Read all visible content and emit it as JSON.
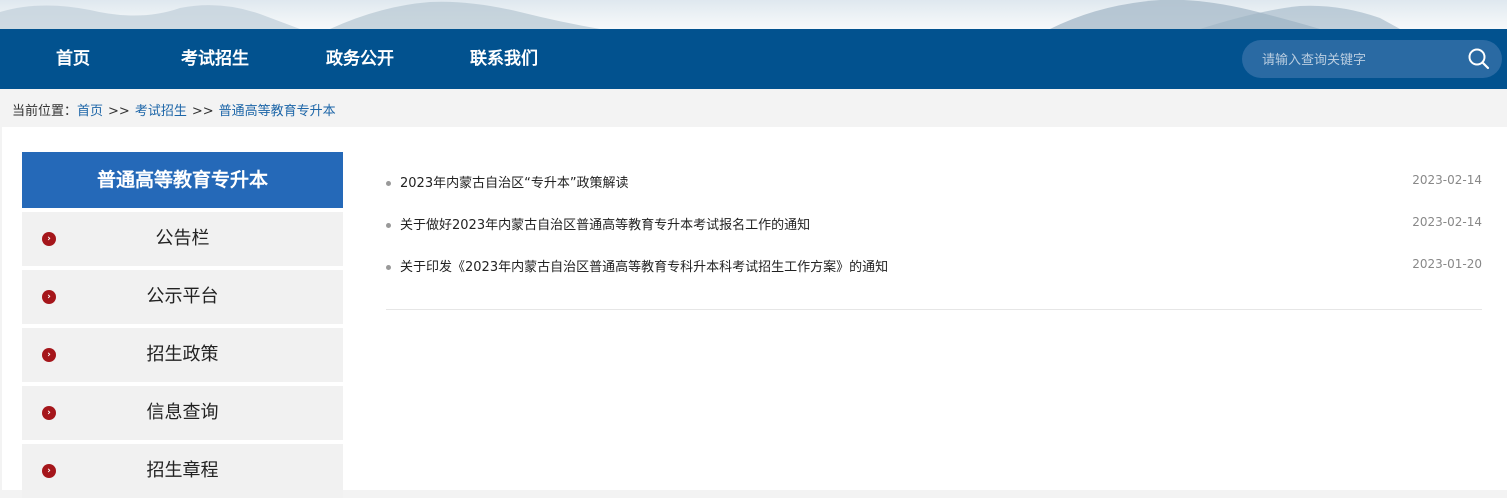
{
  "nav": {
    "items": [
      "首页",
      "考试招生",
      "政务公开",
      "联系我们"
    ]
  },
  "search": {
    "placeholder": "请输入查询关键字"
  },
  "breadcrumb": {
    "prefix": "当前位置：",
    "items": [
      "首页",
      "考试招生",
      "普通高等教育专升本"
    ],
    "separator": ">>"
  },
  "sidebar": {
    "title": "普通高等教育专升本",
    "items": [
      {
        "label": "公告栏"
      },
      {
        "label": "公示平台"
      },
      {
        "label": "招生政策"
      },
      {
        "label": "信息查询"
      },
      {
        "label": "招生章程"
      }
    ]
  },
  "articles": [
    {
      "title": "2023年内蒙古自治区“专升本”政策解读",
      "date": "2023-02-14"
    },
    {
      "title": "关于做好2023年内蒙古自治区普通高等教育专升本考试报名工作的通知",
      "date": "2023-02-14"
    },
    {
      "title": "关于印发《2023年内蒙古自治区普通高等教育专科升本科考试招生工作方案》的通知",
      "date": "2023-01-20"
    }
  ],
  "colors": {
    "nav_bg": "#02528f",
    "sidebar_title_bg": "#2569b8",
    "bullet_red": "#a5161b",
    "link_blue": "#1d66a8"
  },
  "icons": [
    "search-icon",
    "chevron-right-icon",
    "mountain-banner"
  ]
}
